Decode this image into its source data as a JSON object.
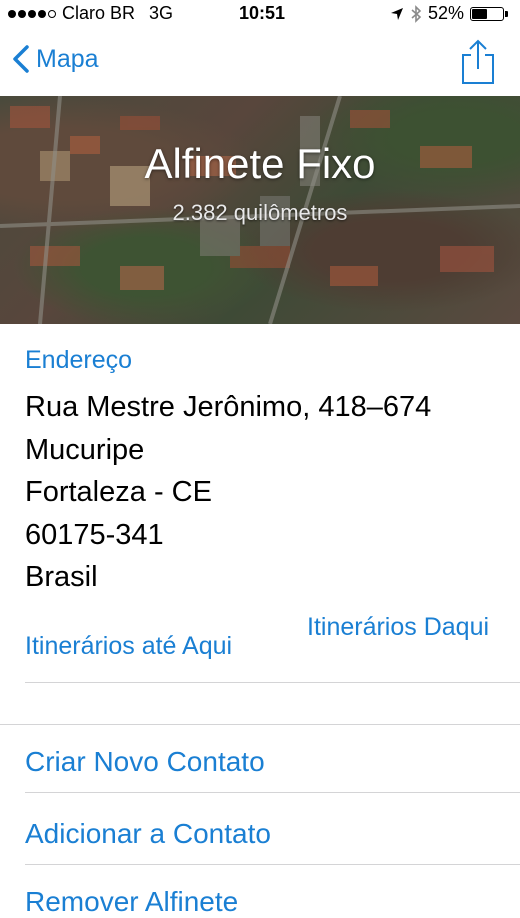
{
  "status_bar": {
    "carrier": "Claro BR",
    "network": "3G",
    "time": "10:51",
    "battery_percent": "52%",
    "signal_bars": 4,
    "battery_level": 0.52
  },
  "nav": {
    "back_label": "Mapa"
  },
  "hero": {
    "title": "Alfinete Fixo",
    "distance": "2.382 quilômetros"
  },
  "address": {
    "label": "Endereço",
    "lines": [
      "Rua Mestre Jerônimo, 418–674",
      "Mucuripe",
      "Fortaleza - CE",
      "60175-341",
      "Brasil"
    ]
  },
  "directions": {
    "to_here": "Itinerários até Aqui",
    "from_here": "Itinerários Daqui"
  },
  "actions": {
    "create_contact": "Criar Novo Contato",
    "add_to_contact": "Adicionar a Contato",
    "remove_pin": "Remover Alfinete"
  },
  "colors": {
    "accent": "#1a7fd3",
    "separator": "#d4d4d6"
  }
}
